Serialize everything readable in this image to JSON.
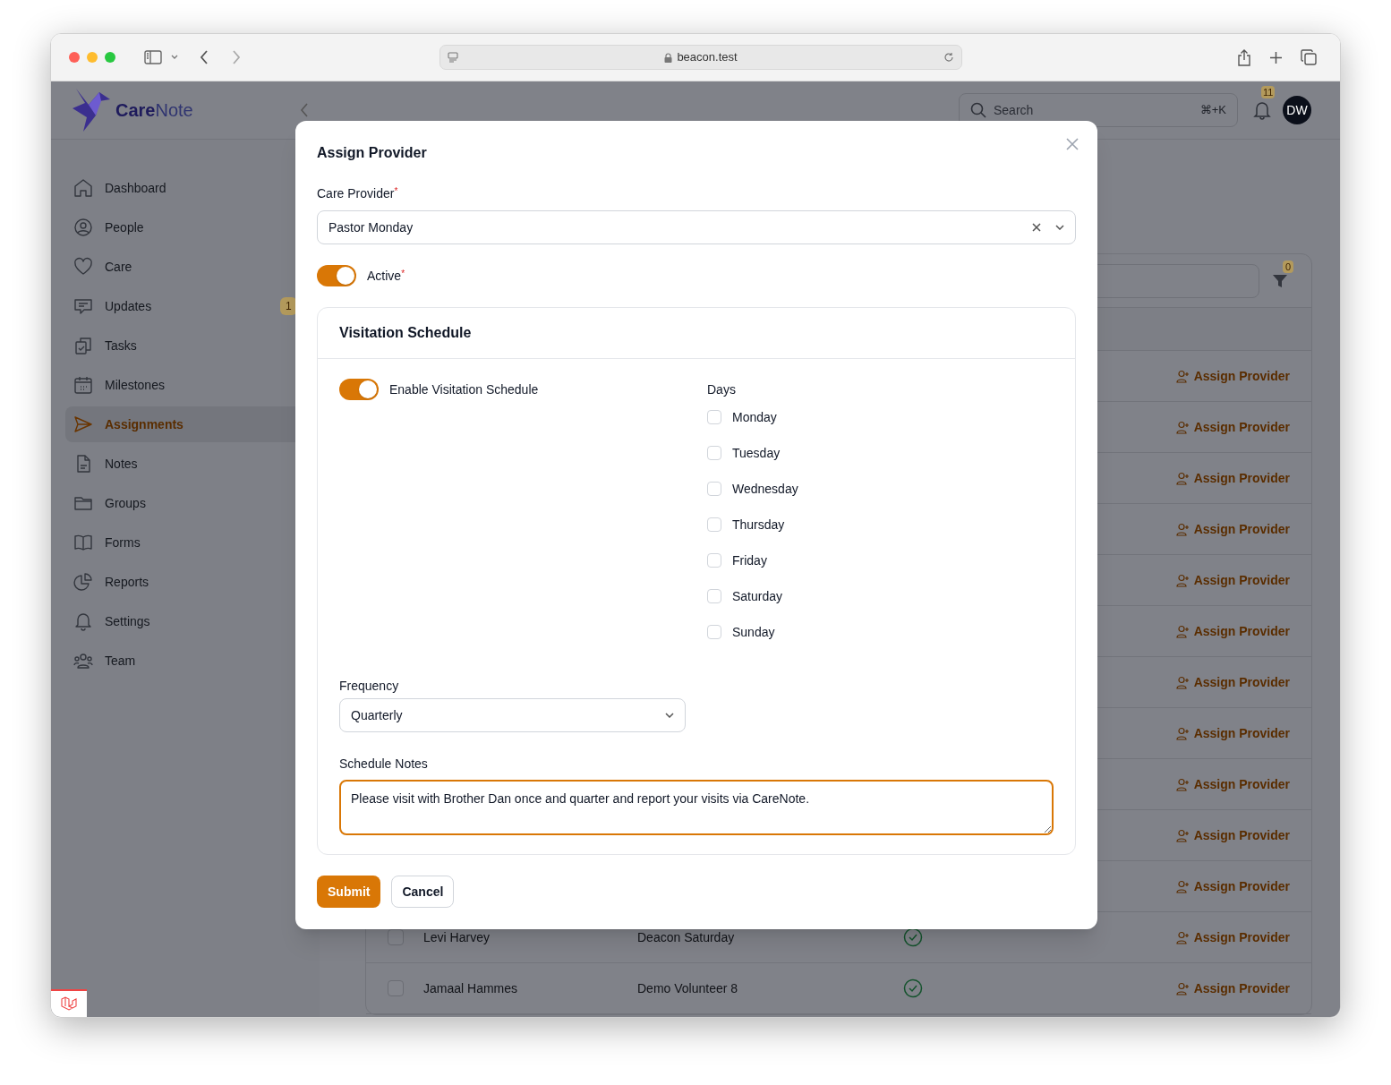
{
  "browser": {
    "address": "beacon.test"
  },
  "header": {
    "brand_first": "Care",
    "brand_second": "Note",
    "search": {
      "placeholder": "Search",
      "shortcut": "⌘+K"
    },
    "notification_count": "11",
    "avatar": "DW"
  },
  "sidebar": {
    "items": [
      {
        "label": "Dashboard",
        "selected": false
      },
      {
        "label": "People",
        "selected": false
      },
      {
        "label": "Care",
        "selected": false
      },
      {
        "label": "Updates",
        "selected": false,
        "badge": "1"
      },
      {
        "label": "Tasks",
        "selected": false
      },
      {
        "label": "Milestones",
        "selected": false
      },
      {
        "label": "Assignments",
        "selected": true
      },
      {
        "label": "Notes",
        "selected": false
      },
      {
        "label": "Groups",
        "selected": false
      },
      {
        "label": "Forms",
        "selected": false
      },
      {
        "label": "Reports",
        "selected": false
      },
      {
        "label": "Settings",
        "selected": false
      },
      {
        "label": "Team",
        "selected": false
      }
    ]
  },
  "table": {
    "filter_count": "0",
    "rows": [
      {
        "action": "Assign Provider"
      },
      {
        "action": "Assign Provider"
      },
      {
        "action": "Assign Provider"
      },
      {
        "action": "Assign Provider"
      },
      {
        "action": "Assign Provider"
      },
      {
        "action": "Assign Provider"
      },
      {
        "action": "Assign Provider"
      },
      {
        "action": "Assign Provider"
      },
      {
        "action": "Assign Provider"
      },
      {
        "action": "Assign Provider"
      },
      {
        "action": "Assign Provider"
      },
      {
        "checked": false,
        "name": "Levi Harvey",
        "provider": "Deacon Saturday",
        "active": true,
        "action": "Assign Provider"
      },
      {
        "checked": false,
        "name": "Jamaal Hammes",
        "provider": "Demo Volunteer 8",
        "active": true,
        "action": "Assign Provider"
      }
    ]
  },
  "modal": {
    "title": "Assign Provider",
    "care_provider": {
      "label": "Care Provider",
      "required_mark": "*",
      "value": "Pastor Monday"
    },
    "active": {
      "label": "Active",
      "required_mark": "*",
      "on": true
    },
    "schedule": {
      "title": "Visitation Schedule",
      "enable": {
        "label": "Enable Visitation Schedule",
        "on": true
      },
      "days_label": "Days",
      "days": [
        {
          "label": "Monday",
          "checked": false
        },
        {
          "label": "Tuesday",
          "checked": false
        },
        {
          "label": "Wednesday",
          "checked": false
        },
        {
          "label": "Thursday",
          "checked": false
        },
        {
          "label": "Friday",
          "checked": false
        },
        {
          "label": "Saturday",
          "checked": false
        },
        {
          "label": "Sunday",
          "checked": false
        }
      ],
      "frequency": {
        "label": "Frequency",
        "value": "Quarterly"
      },
      "notes": {
        "label": "Schedule Notes",
        "value": "Please visit with Brother Dan once and quarter and report your visits via CareNote."
      }
    },
    "buttons": [
      {
        "label": "Submit",
        "kind": "primary"
      },
      {
        "label": "Cancel",
        "kind": "secondary"
      }
    ]
  }
}
